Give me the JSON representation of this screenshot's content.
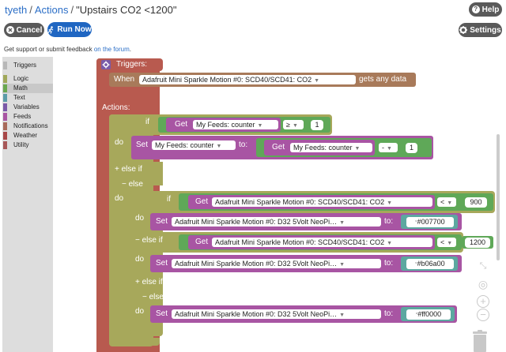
{
  "header": {
    "crumbs": [
      "tyeth",
      "Actions",
      "\"Upstairs CO2 <1200\""
    ],
    "separator": "/",
    "help_label": "Help",
    "help_icon": "?",
    "cancel_label": "Cancel",
    "run_label": "Run Now",
    "settings_label": "Settings",
    "feedback_text": "Get support or submit feedback ",
    "feedback_link": "on the forum",
    "feedback_end": "."
  },
  "toolbox": {
    "categories": [
      {
        "label": "Triggers",
        "color": "#b8b8b8"
      },
      {
        "label": "Logic",
        "color": "#a0a85a"
      },
      {
        "label": "Math",
        "color": "#6aa84f"
      },
      {
        "label": "Text",
        "color": "#5c9ca8"
      },
      {
        "label": "Variables",
        "color": "#7a5aa8"
      },
      {
        "label": "Feeds",
        "color": "#a855a3"
      },
      {
        "label": "Notifications",
        "color": "#a86a5a"
      },
      {
        "label": "Weather",
        "color": "#a84848"
      },
      {
        "label": "Utility",
        "color": "#a85858"
      }
    ],
    "selected": "Math"
  },
  "blocks": {
    "triggers_label": "Triggers:",
    "when_label": "When",
    "when_feed": "Adafruit Mini Sparkle Motion #0: SCD40/SCD41: CO2",
    "when_suffix": "gets any data",
    "actions_label": "Actions:",
    "if1": {
      "if_label": "if",
      "get_label": "Get",
      "feed": "My Feeds: counter",
      "op": "≥",
      "value": "1",
      "do_label": "do",
      "set_label": "Set",
      "set_feed": "My Feeds: counter",
      "to_label": "to:",
      "get2_label": "Get",
      "get2_feed": "My Feeds: counter",
      "op2": "-",
      "value2": "1",
      "else_if_label": "+ else if",
      "else_label": "−  else",
      "else_do_label": "do"
    },
    "if2": {
      "if_label": "if",
      "get_label": "Get",
      "feed": "Adafruit Mini Sparkle Motion #0: SCD40/SCD41: CO2",
      "op": "<",
      "value": "900",
      "do_label": "do",
      "set_label": "Set",
      "set_feed": "Adafruit Mini Sparkle Motion #0: D32 5Volt NeoPi…",
      "to_label": "to:",
      "color_value": "#007700",
      "else_if_label": "−  else if",
      "get2_label": "Get",
      "feed2": "Adafruit Mini Sparkle Motion #0: SCD40/SCD41: CO2",
      "op2": "<",
      "value2": "1200",
      "do2_label": "do",
      "set2_label": "Set",
      "set2_feed": "Adafruit Mini Sparkle Motion #0: D32 5Volt NeoPi…",
      "to2_label": "to:",
      "color_value2": "#b06a00",
      "add_else_if_label": "+ else if",
      "else_label": "−  else",
      "do3_label": "do",
      "set3_label": "Set",
      "set3_feed": "Adafruit Mini Sparkle Motion #0: D32 5Volt NeoPi…",
      "to3_label": "to:",
      "color_value3": "#ff0000"
    }
  },
  "colors": {
    "logic": "#a7a85b",
    "math": "#5fa858",
    "feeds": "#a855a3",
    "trigger": "#a87a5a",
    "action_root": "#b85a4f",
    "text": "#5ca8a0",
    "primary_button": "#1f66c2",
    "secondary_button": "#5a5a5a",
    "link": "#2c6fc7"
  },
  "controls": {
    "expand_icon": "⤡",
    "center_icon": "◎",
    "zoom_in_icon": "+",
    "zoom_out_icon": "−",
    "trash_icon": "trash"
  }
}
